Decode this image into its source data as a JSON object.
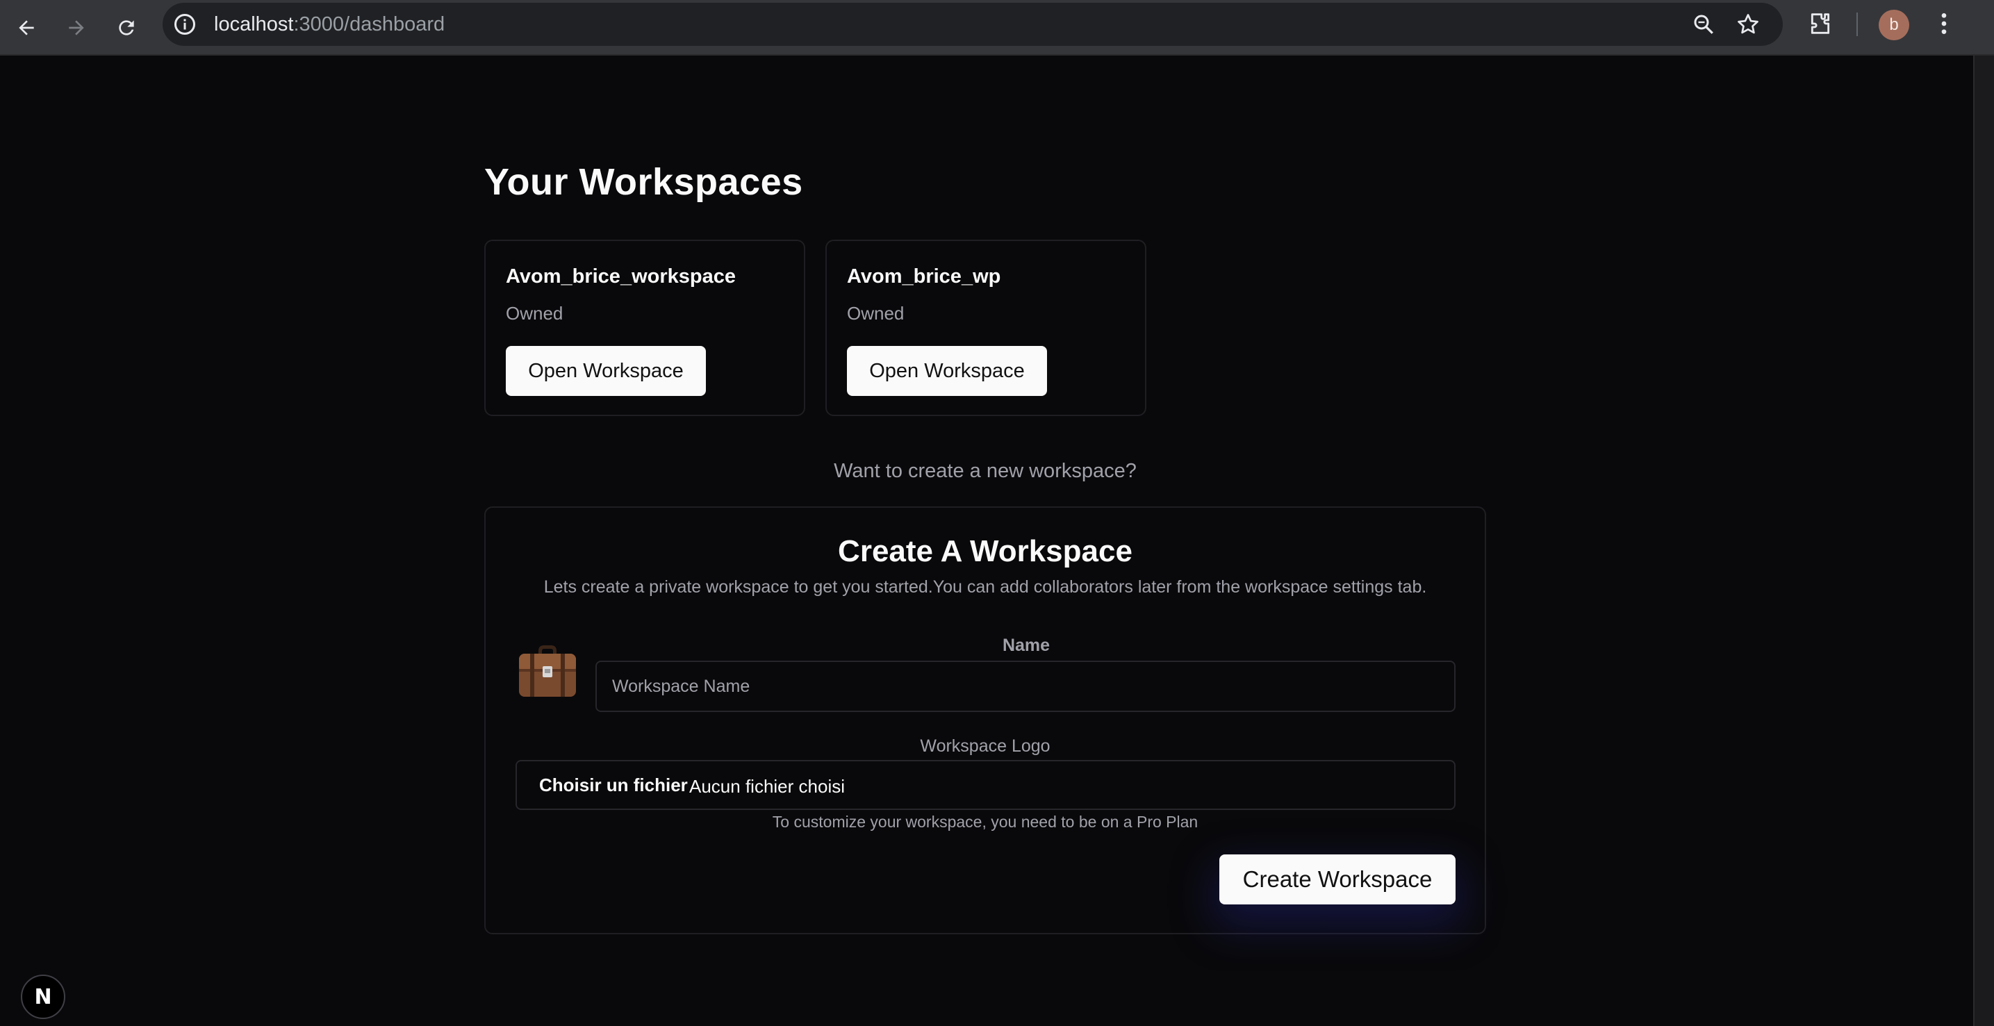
{
  "browser": {
    "url_host": "localhost",
    "url_path": ":3000/dashboard",
    "profile_initial": "b",
    "icons": [
      "back-icon",
      "forward-icon",
      "reload-icon",
      "info-icon",
      "zoom-icon",
      "star-icon",
      "extensions-icon",
      "more-icon"
    ]
  },
  "page": {
    "title": "Your Workspaces",
    "workspaces": [
      {
        "name": "Avom_brice_workspace",
        "role": "Owned",
        "button": "Open Workspace"
      },
      {
        "name": "Avom_brice_wp",
        "role": "Owned",
        "button": "Open Workspace"
      }
    ],
    "create_prompt": "Want to create a new workspace?"
  },
  "create_form": {
    "title": "Create A Workspace",
    "description": "Lets create a private workspace to get you started.You can add collaborators later from the workspace settings tab.",
    "emoji_icon": "briefcase-icon",
    "name_label": "Name",
    "name_placeholder": "Workspace Name",
    "logo_label": "Workspace Logo",
    "file_button": "Choisir un fichier",
    "file_status": "Aucun fichier choisi",
    "pro_note": "To customize your workspace, you need to be on a Pro Plan",
    "submit_label": "Create Workspace"
  },
  "dev_badge": {
    "letter": "N"
  }
}
